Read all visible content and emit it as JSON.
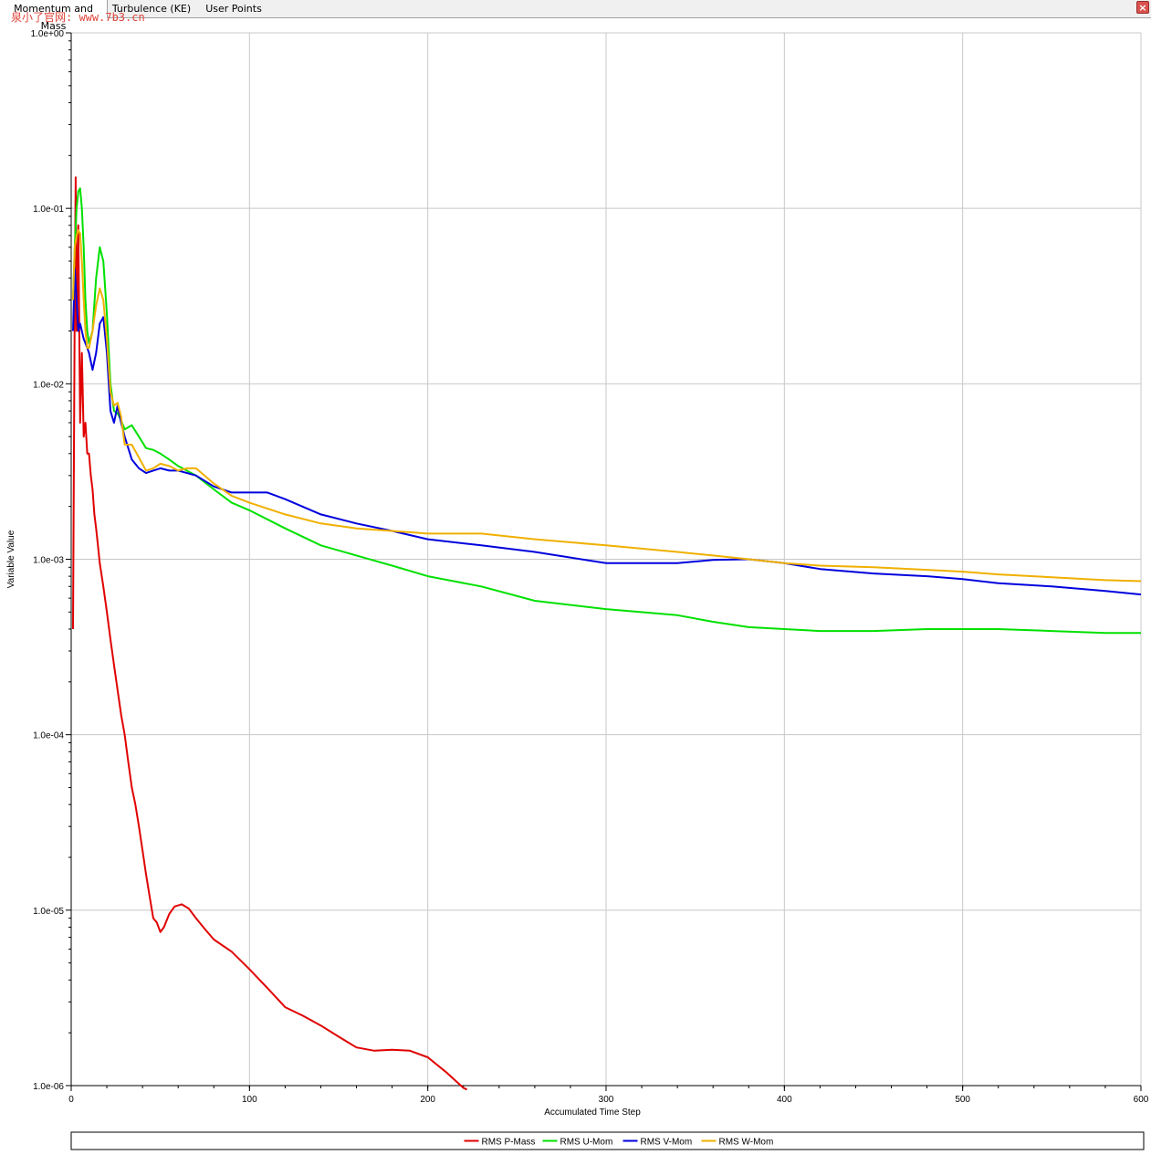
{
  "tabs": [
    {
      "label": "Momentum and Mass",
      "active": true
    },
    {
      "label": "Turbulence (KE)",
      "active": false
    },
    {
      "label": "User Points",
      "active": false
    }
  ],
  "close_icon": "close-icon",
  "watermark": "泉小了官网: www.7b3.cn",
  "chart_data": {
    "type": "line",
    "xlabel": "Accumulated Time Step",
    "ylabel": "Variable Value",
    "xlim": [
      0,
      600
    ],
    "ylim": [
      1e-06,
      1
    ],
    "yscale": "log",
    "grid": true,
    "legend_position": "bottom",
    "x_ticks": [
      0,
      100,
      200,
      300,
      400,
      500,
      600
    ],
    "x_tick_labels": [
      "0",
      "100",
      "200",
      "300",
      "400",
      "500",
      "600"
    ],
    "y_ticks": [
      1e-06,
      1e-05,
      0.0001,
      0.001,
      0.01,
      0.1,
      1
    ],
    "y_tick_labels": [
      "1.0e-06",
      "1.0e-05",
      "1.0e-04",
      "1.0e-03",
      "1.0e-02",
      "1.0e-01",
      "1.0e+00"
    ],
    "series": [
      {
        "name": "RMS P-Mass",
        "color": "#e00000",
        "x": [
          1,
          2,
          2.5,
          3,
          4,
          5,
          6,
          7,
          8,
          9,
          10,
          11,
          12,
          13,
          14,
          15,
          16,
          18,
          20,
          22,
          24,
          26,
          28,
          30,
          32,
          34,
          36,
          38,
          40,
          42,
          44,
          46,
          48,
          50,
          52,
          55,
          58,
          62,
          66,
          70,
          75,
          80,
          90,
          100,
          110,
          120,
          130,
          140,
          150,
          160,
          170,
          180,
          190,
          200,
          210,
          220,
          222
        ],
        "y": [
          0.0004,
          0.03,
          0.15,
          0.02,
          0.08,
          0.006,
          0.015,
          0.005,
          0.006,
          0.004,
          0.004,
          0.003,
          0.0025,
          0.0018,
          0.0015,
          0.0012,
          0.00095,
          0.0007,
          0.0005,
          0.00035,
          0.00025,
          0.00018,
          0.00013,
          0.0001,
          7e-05,
          5e-05,
          4e-05,
          3e-05,
          2.2e-05,
          1.6e-05,
          1.2e-05,
          9e-06,
          8.5e-06,
          7.5e-06,
          8e-06,
          9.5e-06,
          1.05e-05,
          1.08e-05,
          1.02e-05,
          9e-06,
          7.8e-06,
          6.8e-06,
          5.8e-06,
          4.6e-06,
          3.6e-06,
          2.8e-06,
          2.5e-06,
          2.2e-06,
          1.9e-06,
          1.65e-06,
          1.58e-06,
          1.6e-06,
          1.58e-06,
          1.45e-06,
          1.2e-06,
          9.7e-07,
          9.5e-07
        ]
      },
      {
        "name": "RMS U-Mom",
        "color": "#00e000",
        "x": [
          1,
          2,
          3,
          4,
          5,
          6,
          7,
          8,
          9,
          10,
          12,
          14,
          16,
          18,
          20,
          22,
          24,
          26,
          28,
          30,
          34,
          38,
          42,
          46,
          50,
          55,
          60,
          70,
          80,
          90,
          100,
          120,
          140,
          160,
          180,
          200,
          230,
          260,
          300,
          340,
          360,
          380,
          400,
          420,
          450,
          480,
          500,
          520,
          550,
          580,
          600
        ],
        "y": [
          0.03,
          0.06,
          0.1,
          0.125,
          0.13,
          0.1,
          0.06,
          0.03,
          0.02,
          0.017,
          0.02,
          0.04,
          0.06,
          0.05,
          0.025,
          0.01,
          0.007,
          0.0068,
          0.0062,
          0.0055,
          0.0058,
          0.005,
          0.0043,
          0.0042,
          0.004,
          0.0037,
          0.0034,
          0.003,
          0.0025,
          0.0021,
          0.0019,
          0.0015,
          0.0012,
          0.00105,
          0.00092,
          0.0008,
          0.0007,
          0.00058,
          0.00052,
          0.00048,
          0.00044,
          0.00041,
          0.0004,
          0.00039,
          0.00039,
          0.0004,
          0.0004,
          0.0004,
          0.00039,
          0.00038,
          0.00038
        ]
      },
      {
        "name": "RMS V-Mom",
        "color": "#0000dd",
        "x": [
          1,
          2,
          3,
          4,
          5,
          6,
          7,
          8,
          9,
          10,
          12,
          14,
          16,
          18,
          20,
          22,
          24,
          26,
          28,
          30,
          34,
          38,
          42,
          46,
          50,
          55,
          60,
          70,
          80,
          90,
          100,
          110,
          120,
          140,
          160,
          180,
          200,
          230,
          260,
          300,
          340,
          360,
          380,
          400,
          420,
          450,
          480,
          500,
          520,
          550,
          580,
          600
        ],
        "y": [
          0.02,
          0.045,
          0.03,
          0.02,
          0.022,
          0.02,
          0.018,
          0.017,
          0.016,
          0.015,
          0.012,
          0.015,
          0.022,
          0.024,
          0.015,
          0.007,
          0.006,
          0.0075,
          0.006,
          0.005,
          0.0037,
          0.0033,
          0.0031,
          0.0032,
          0.0033,
          0.0032,
          0.0032,
          0.003,
          0.0026,
          0.0024,
          0.0024,
          0.0024,
          0.0022,
          0.0018,
          0.0016,
          0.00145,
          0.0013,
          0.0012,
          0.0011,
          0.00095,
          0.00095,
          0.00099,
          0.001,
          0.00095,
          0.00088,
          0.00083,
          0.0008,
          0.00077,
          0.00073,
          0.0007,
          0.00066,
          0.00063
        ]
      },
      {
        "name": "RMS W-Mom",
        "color": "#f0b000",
        "x": [
          1,
          2,
          3,
          4,
          5,
          6,
          7,
          8,
          9,
          10,
          12,
          14,
          16,
          18,
          20,
          22,
          24,
          26,
          28,
          30,
          34,
          38,
          42,
          46,
          50,
          55,
          60,
          65,
          70,
          80,
          90,
          100,
          120,
          140,
          160,
          180,
          200,
          230,
          260,
          300,
          340,
          360,
          380,
          400,
          420,
          450,
          480,
          500,
          520,
          550,
          580,
          600
        ],
        "y": [
          0.03,
          0.06,
          0.07,
          0.075,
          0.072,
          0.05,
          0.03,
          0.02,
          0.016,
          0.016,
          0.02,
          0.028,
          0.035,
          0.03,
          0.018,
          0.009,
          0.0075,
          0.0078,
          0.0065,
          0.0045,
          0.0045,
          0.0038,
          0.0032,
          0.0033,
          0.0035,
          0.0034,
          0.0032,
          0.0033,
          0.0033,
          0.0027,
          0.0023,
          0.0021,
          0.0018,
          0.0016,
          0.0015,
          0.00145,
          0.0014,
          0.0014,
          0.0013,
          0.0012,
          0.0011,
          0.00105,
          0.001,
          0.00095,
          0.00092,
          0.0009,
          0.00087,
          0.00085,
          0.00082,
          0.00079,
          0.00076,
          0.00075
        ]
      }
    ]
  }
}
